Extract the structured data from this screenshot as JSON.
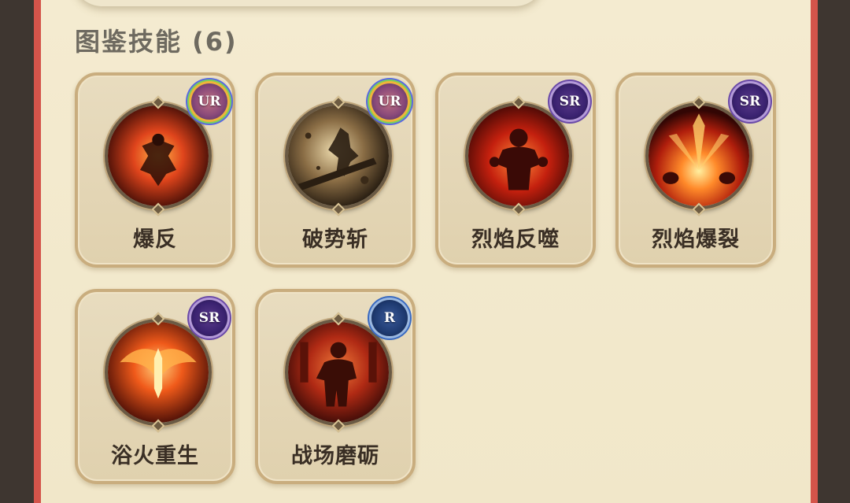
{
  "section": {
    "title": "图鉴技能 (6)"
  },
  "skills": [
    {
      "name": "爆反",
      "rarity": "UR",
      "icon": "exploding-warrior-icon"
    },
    {
      "name": "破势斩",
      "rarity": "UR",
      "icon": "slashing-warrior-icon"
    },
    {
      "name": "烈焰反噬",
      "rarity": "SR",
      "icon": "flame-backlash-icon"
    },
    {
      "name": "烈焰爆裂",
      "rarity": "SR",
      "icon": "flame-burst-icon"
    },
    {
      "name": "浴火重生",
      "rarity": "SR",
      "icon": "phoenix-rebirth-icon"
    },
    {
      "name": "战场磨砺",
      "rarity": "R",
      "icon": "battlefield-warrior-icon"
    }
  ],
  "colors": {
    "panel_bg": "#f2e8cc",
    "frame_red": "#d4544a",
    "card_border": "#c9ad7e",
    "text_dark": "#3a2f25",
    "title_gray": "#6e6a60"
  }
}
